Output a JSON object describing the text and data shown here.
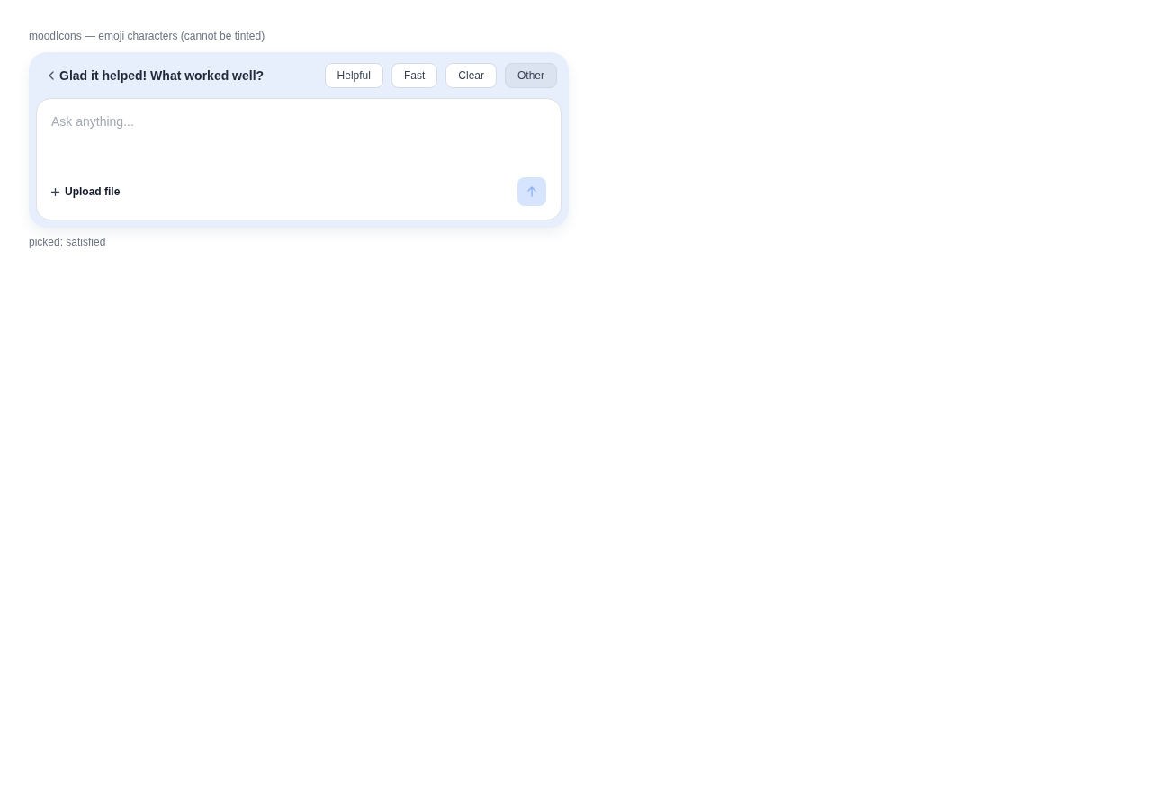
{
  "caption": "moodIcons — emoji characters (cannot be tinted)",
  "panel": {
    "title": "Glad it helped! What worked well?",
    "chips": [
      {
        "label": "Helpful",
        "selected": false
      },
      {
        "label": "Fast",
        "selected": false
      },
      {
        "label": "Clear",
        "selected": false
      },
      {
        "label": "Other",
        "selected": true
      }
    ]
  },
  "composer": {
    "placeholder": "Ask anything...",
    "upload_label": "Upload file",
    "send_disabled": true
  },
  "status": "picked: satisfied"
}
